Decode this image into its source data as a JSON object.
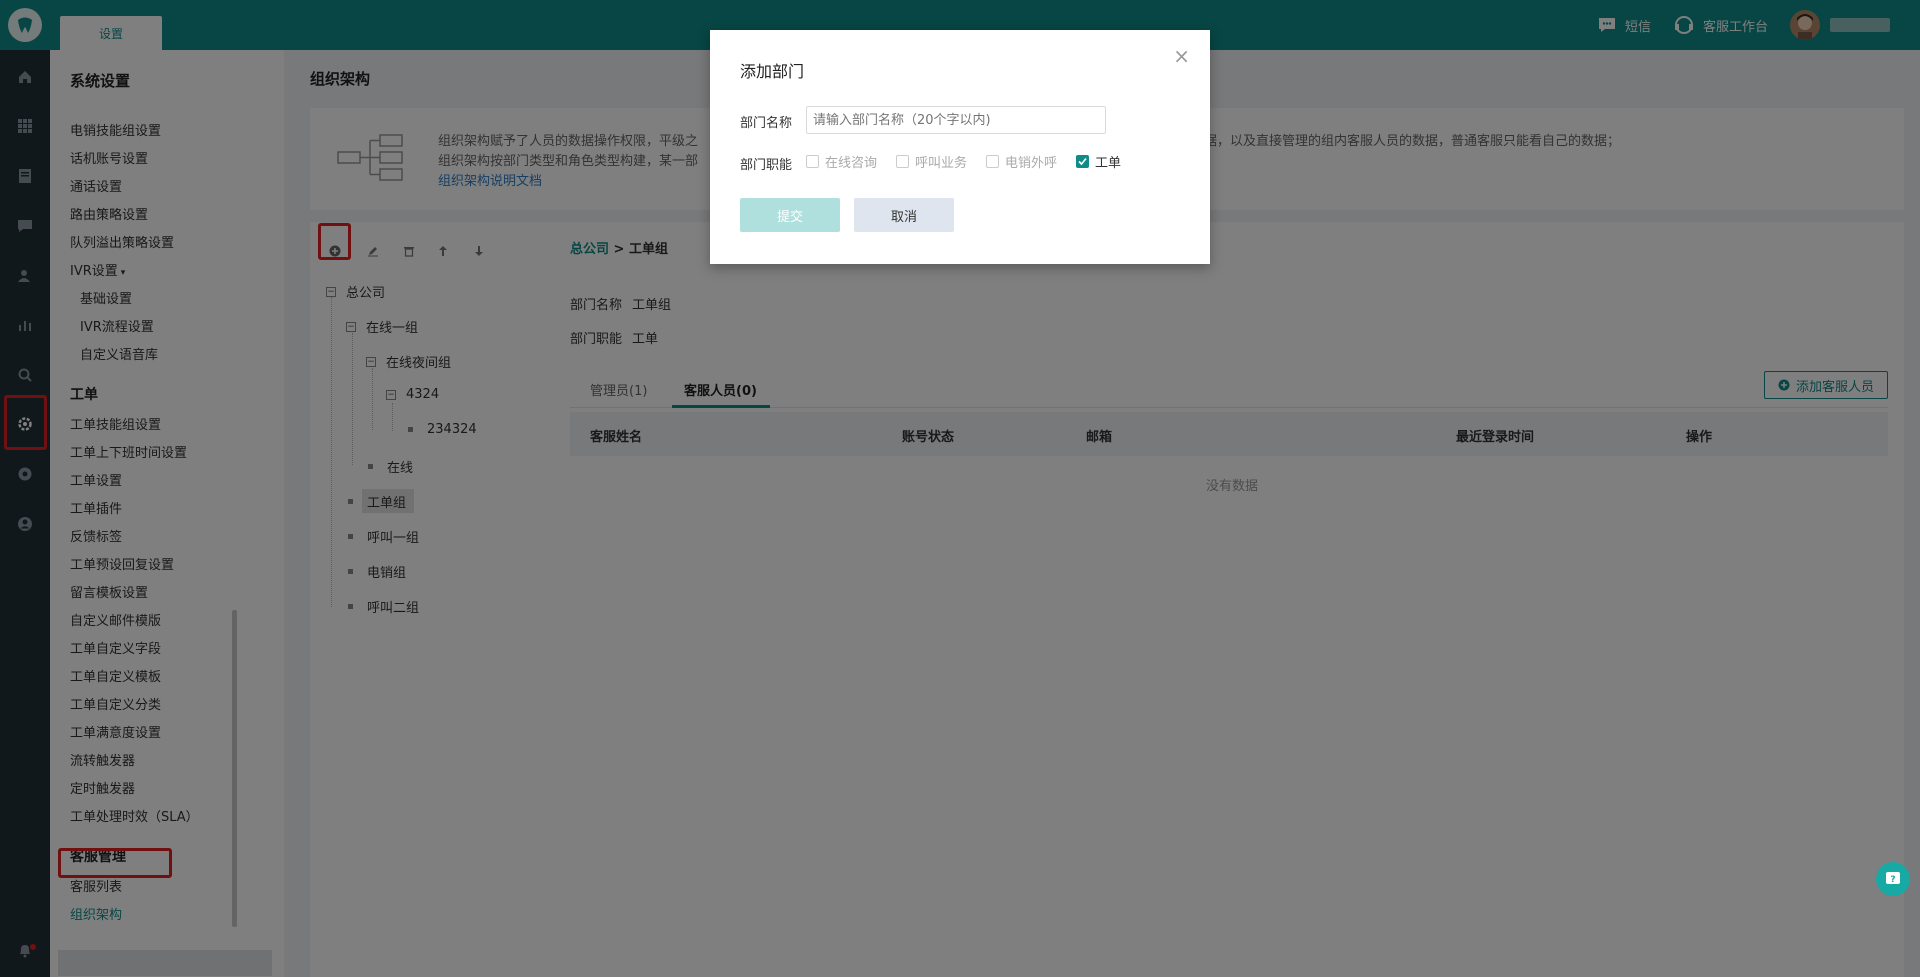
{
  "topbar": {
    "tab_label": "设置",
    "sms_label": "短信",
    "workbench_label": "客服工作台"
  },
  "colors": {
    "brand": "#0f8c88",
    "highlight": "#e02020"
  },
  "rail": {
    "icons": [
      "home-icon",
      "apps-icon",
      "document-icon",
      "chat-icon",
      "contacts-icon",
      "stats-icon",
      "search-icon",
      "settings-icon",
      "compass-icon",
      "user-icon",
      "bell-icon"
    ]
  },
  "sidebar": {
    "title": "系统设置",
    "items": [
      "电销技能组设置",
      "话机账号设置",
      "通话设置",
      "路由策略设置",
      "队列溢出策略设置",
      "IVR设置"
    ],
    "ivr_subitems": [
      "基础设置",
      "IVR流程设置",
      "自定义语音库"
    ],
    "ticket_group": "工单",
    "ticket_items": [
      "工单技能组设置",
      "工单上下班时间设置",
      "工单设置",
      "工单插件",
      "反馈标签",
      "工单预设回复设置",
      "留言模板设置",
      "自定义邮件模版",
      "工单自定义字段",
      "工单自定义模板",
      "工单自定义分类",
      "工单满意度设置",
      "流转触发器",
      "定时触发器",
      "工单处理时效（SLA）"
    ],
    "staff_group": "客服管理",
    "staff_items": [
      "客服列表",
      "组织架构"
    ]
  },
  "main": {
    "title": "组织架构",
    "info_line1": "组织架构赋予了人员的数据操作权限，平级之",
    "info_line1_tail": "的数据，以及直接管理的组内客服人员的数据，普通客服只能看自己的数据；",
    "info_line2": "组织架构按部门类型和角色类型构建，某一部",
    "info_link": "组织架构说明文档",
    "tree": {
      "root": "总公司",
      "n1": "在线一组",
      "n1a": "在线夜间组",
      "n1a1": "4324",
      "n1a1a": "234324",
      "n1b": "在线",
      "n2": "工单组",
      "n3": "呼叫一组",
      "n4": "电销组",
      "n5": "呼叫二组"
    },
    "breadcrumb_root": "总公司",
    "breadcrumb_sep": ">",
    "breadcrumb_current": "工单组",
    "dept_name_label": "部门名称",
    "dept_name_value": "工单组",
    "dept_func_label": "部门职能",
    "dept_func_value": "工单",
    "tab_admin": "管理员(1)",
    "tab_staff": "客服人员(0)",
    "add_staff": "添加客服人员",
    "table_headers": [
      "客服姓名",
      "账号状态",
      "邮箱",
      "最近登录时间",
      "操作"
    ],
    "empty_text": "没有数据"
  },
  "modal": {
    "title": "添加部门",
    "name_label": "部门名称",
    "name_placeholder": "请输入部门名称（20个字以内)",
    "func_label": "部门职能",
    "options": [
      {
        "label": "在线咨询",
        "checked": false,
        "disabled": true
      },
      {
        "label": "呼叫业务",
        "checked": false,
        "disabled": true
      },
      {
        "label": "电销外呼",
        "checked": false,
        "disabled": true
      },
      {
        "label": "工单",
        "checked": true,
        "disabled": false
      }
    ],
    "submit": "提交",
    "cancel": "取消"
  }
}
